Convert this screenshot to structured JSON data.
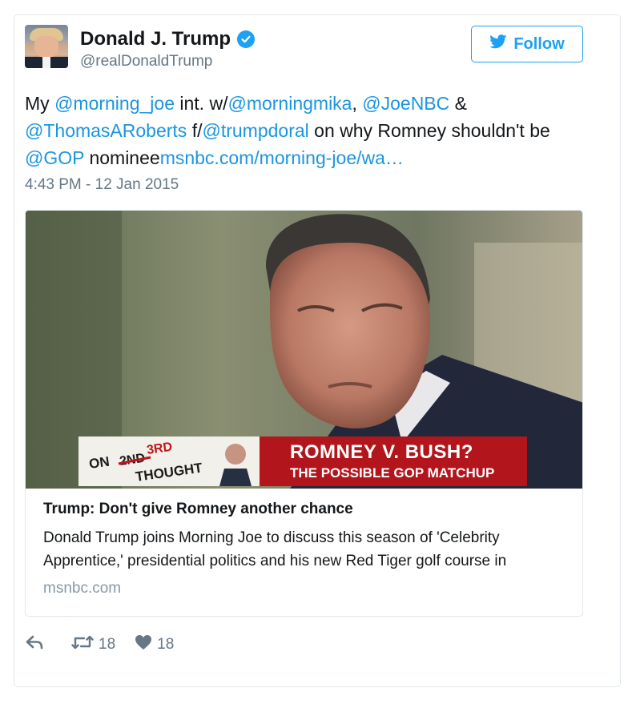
{
  "author": {
    "name": "Donald J. Trump",
    "handle": "@realDonaldTrump",
    "verified": true
  },
  "follow_button": {
    "label": "Follow",
    "icon": "bird-icon"
  },
  "tweet": {
    "segments": [
      {
        "text": "My ",
        "link": false
      },
      {
        "text": "@morning_joe",
        "link": true
      },
      {
        "text": " int. w/",
        "link": false
      },
      {
        "text": "@morningmika",
        "link": true
      },
      {
        "text": ", ",
        "link": false
      },
      {
        "text": "@JoeNBC",
        "link": true
      },
      {
        "text": " & ",
        "link": false
      },
      {
        "text": "@ThomasARoberts",
        "link": true
      },
      {
        "text": " f/",
        "link": false
      },
      {
        "text": "@trumpdoral",
        "link": true
      },
      {
        "text": " on why Romney shouldn't be ",
        "link": false
      },
      {
        "text": "@GOP",
        "link": true
      },
      {
        "text": " nominee",
        "link": false
      },
      {
        "text": "msnbc.com/morning-joe/wa…",
        "link": true
      }
    ],
    "timestamp": "4:43 PM - 12 Jan 2015"
  },
  "media_card": {
    "banner": {
      "left_prefix": "ON",
      "struck": "2ND",
      "corrected": "3RD",
      "left_suffix": "THOUGHT",
      "headline": "ROMNEY V. BUSH?",
      "subheadline": "THE POSSIBLE GOP MATCHUP"
    },
    "title": "Trump: Don't give Romney another chance",
    "description": "Donald Trump joins Morning Joe to discuss this season of 'Celebrity Apprentice,' presidential politics and his new Red Tiger golf course in",
    "domain": "msnbc.com"
  },
  "actions": {
    "reply_icon": "reply-icon",
    "retweet_icon": "retweet-icon",
    "like_icon": "heart-icon",
    "retweet_count": "18",
    "like_count": "18"
  },
  "colors": {
    "link": "#1b95e0",
    "follow": "#1da1f2",
    "secondary_text": "#657786",
    "banner_red": "#b3151c"
  }
}
